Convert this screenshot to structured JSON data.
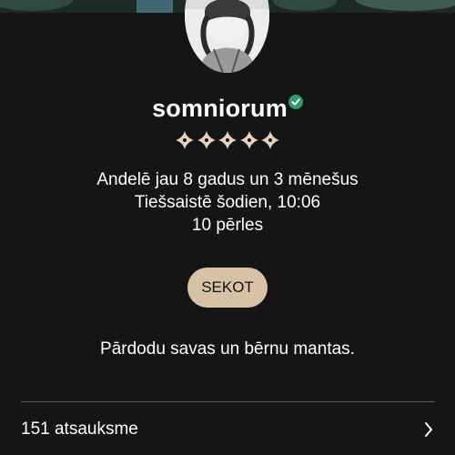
{
  "profile": {
    "username": "somniorum",
    "verified_icon": "verified-check-icon",
    "badge_icon": "pearl-flower-icon",
    "badge_count": 5,
    "member_since": "Andelē jau 8 gadus un 3 mēnešus",
    "last_online": "Tiešsaistē šodien, 10:06",
    "pearls": "10 pērles",
    "follow_label": "SEKOT",
    "description": "Pārdodu savas un bērnu mantas."
  },
  "reviews": {
    "label": "151 atsauksme",
    "chevron_icon": "chevron-right-icon"
  },
  "colors": {
    "background": "#151515",
    "follow_button": "#d8c2a6",
    "verified": "#2e9e70",
    "badge": "#e6d3bd",
    "divider": "#5a5a5a"
  }
}
